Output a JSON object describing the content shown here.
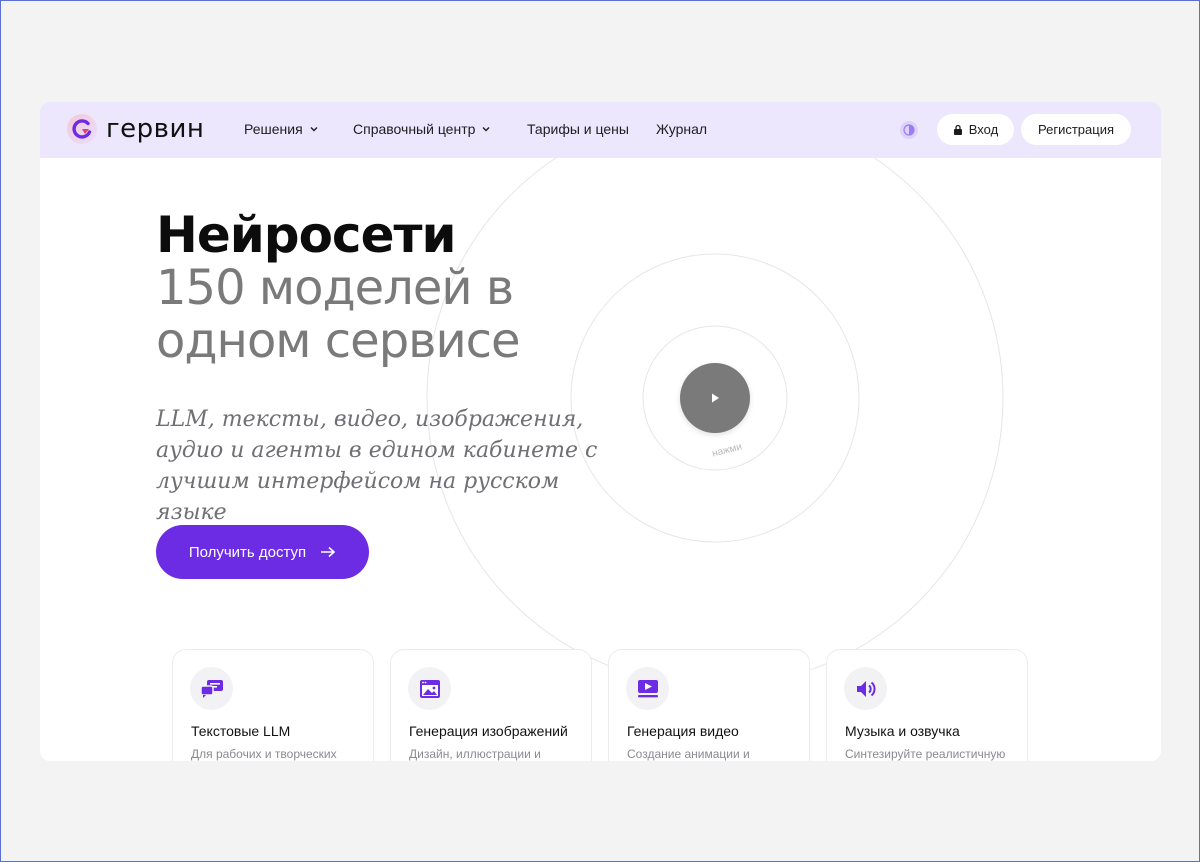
{
  "header": {
    "brand": "гервин",
    "nav": [
      {
        "label": "Решения",
        "has_dropdown": true
      },
      {
        "label": "Справочный центр",
        "has_dropdown": true
      },
      {
        "label": "Тарифы и цены",
        "has_dropdown": false
      },
      {
        "label": "Журнал",
        "has_dropdown": false
      }
    ],
    "login_label": "Вход",
    "register_label": "Регистрация"
  },
  "hero": {
    "title_line1": "Нейросети",
    "title_line2": "150 моделей в одном сервисе",
    "subtitle": "LLM, тексты, видео, изображения, аудио и агенты в едином кабинете с лучшим интерфейсом на русском языке",
    "cta_label": "Получить доступ",
    "play_hint": "нажми"
  },
  "cards": [
    {
      "title": "Текстовые LLM",
      "desc": "Для рабочих и творческих",
      "icon": "chat-bubbles-icon"
    },
    {
      "title": "Генерация изображений",
      "desc": "Дизайн, иллюстрации и",
      "icon": "image-window-icon"
    },
    {
      "title": "Генерация видео",
      "desc": "Создание анимации и",
      "icon": "video-screen-icon"
    },
    {
      "title": "Музыка и озвучка",
      "desc": "Синтезируйте реалистичную",
      "icon": "speaker-icon"
    }
  ],
  "colors": {
    "accent": "#6c2ce4",
    "nav_background": "#ece7fd",
    "page_background": "#f3f3f4",
    "play_button": "#7a7a7a"
  }
}
